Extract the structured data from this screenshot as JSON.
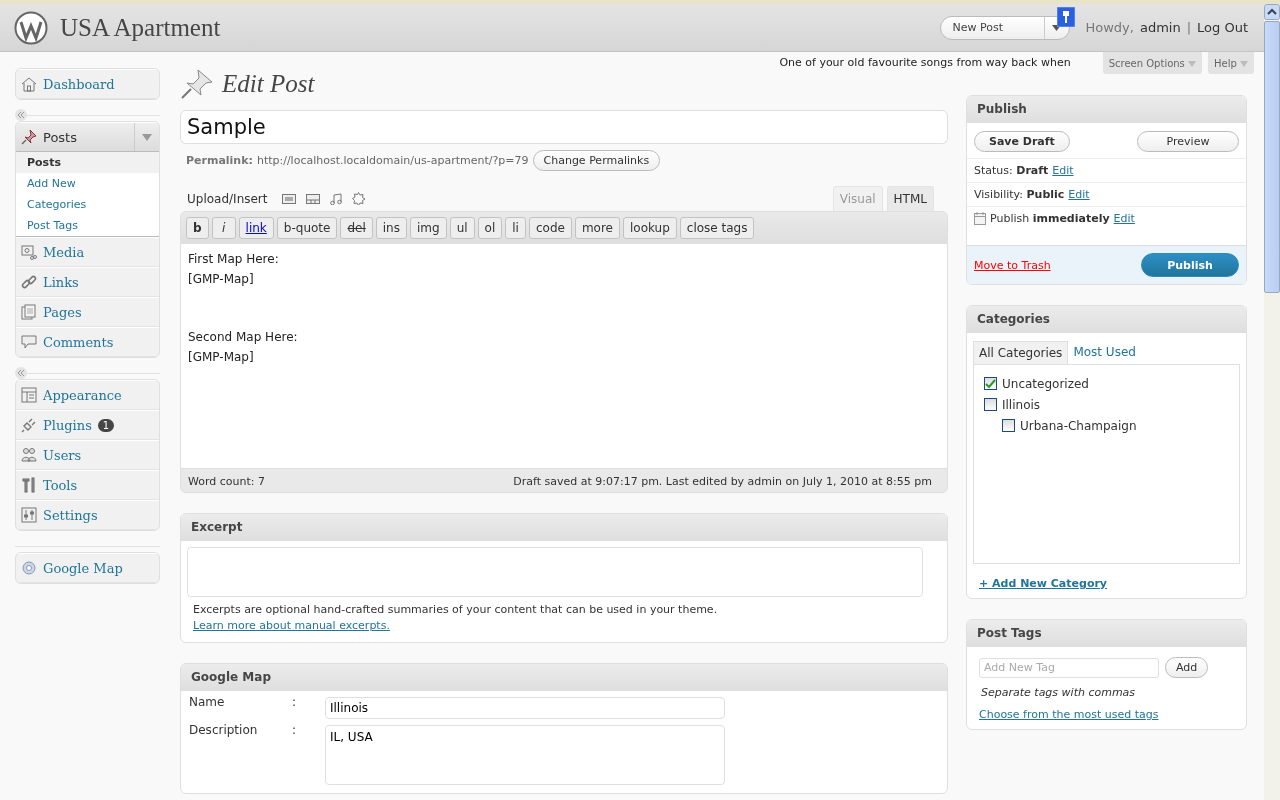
{
  "header": {
    "site_title": "USA Apartment",
    "new_post_button": "New Post",
    "greeting": "Howdy,",
    "user": "admin",
    "separator": "|",
    "logout": "Log Out"
  },
  "topbar": {
    "tagline": "One of your old favourite songs from way back when",
    "screen_options": "Screen Options",
    "help": "Help"
  },
  "page_title": "Edit Post",
  "sidebar": {
    "groups": [
      [
        {
          "label": "Dashboard"
        }
      ],
      [
        {
          "label": "Posts",
          "expanded": true,
          "children": [
            {
              "label": "Posts",
              "selected": true
            },
            {
              "label": "Add New",
              "selected": false
            },
            {
              "label": "Categories",
              "selected": false
            },
            {
              "label": "Post Tags",
              "selected": false
            }
          ]
        },
        {
          "label": "Media",
          "expanded": false
        },
        {
          "label": "Links",
          "expanded": false
        },
        {
          "label": "Pages",
          "expanded": false
        },
        {
          "label": "Comments",
          "expanded": false
        }
      ],
      [
        {
          "label": "Appearance"
        },
        {
          "label": "Plugins",
          "badge": "1"
        },
        {
          "label": "Users"
        },
        {
          "label": "Tools"
        },
        {
          "label": "Settings"
        }
      ],
      [
        {
          "label": "Google Map"
        }
      ]
    ]
  },
  "post": {
    "title": "Sample",
    "permalink_label": "Permalink:",
    "permalink_url": "http://localhost.localdomain/us-apartment/?p=79",
    "change_permalinks": "Change Permalinks"
  },
  "editor": {
    "upload_label": "Upload/Insert",
    "tabs": [
      {
        "label": "Visual",
        "selected": false
      },
      {
        "label": "HTML",
        "selected": true
      }
    ],
    "quicktags": [
      "b",
      "i",
      "link",
      "b-quote",
      "del",
      "ins",
      "img",
      "ul",
      "ol",
      "li",
      "code",
      "more",
      "lookup",
      "close tags"
    ],
    "content": "First Map Here:\n[GMP-Map]\n\n\nSecond Map Here:\n[GMP-Map]",
    "word_count": "Word count: 7",
    "save_status": "Draft saved at 9:07:17 pm. Last edited by admin on July 1, 2010 at 8:55 pm"
  },
  "excerpt": {
    "title": "Excerpt",
    "help": "Excerpts are optional hand-crafted summaries of your content that can be used in your theme.",
    "help_link": "Learn more about manual excerpts."
  },
  "google_map": {
    "title": "Google Map",
    "fields": [
      {
        "label": "Name",
        "colon": ":",
        "value": "Illinois",
        "kind": "input"
      },
      {
        "label": "Description",
        "colon": ":",
        "value": "IL, USA",
        "kind": "textarea"
      }
    ]
  },
  "publish": {
    "title": "Publish",
    "save_draft": "Save Draft",
    "preview": "Preview",
    "rows": [
      {
        "label": "Status:",
        "value": "Draft",
        "link": "Edit",
        "kind": "plain"
      },
      {
        "label": "Visibility:",
        "value": "Public",
        "link": "Edit",
        "kind": "plain"
      },
      {
        "label": "Publish",
        "value": "immediately",
        "link": "Edit",
        "kind": "calendar"
      }
    ],
    "trash": "Move to Trash",
    "publish_button": "Publish"
  },
  "categories": {
    "title": "Categories",
    "tabs": [
      {
        "label": "All Categories",
        "selected": true
      },
      {
        "label": "Most Used",
        "selected": false
      }
    ],
    "items": [
      {
        "label": "Uncategorized",
        "checked": true
      },
      {
        "label": "Illinois",
        "checked": false,
        "children": [
          {
            "label": "Urbana-Champaign",
            "checked": false
          }
        ]
      }
    ],
    "add_link": "+ Add New Category"
  },
  "tags": {
    "title": "Post Tags",
    "placeholder": "Add New Tag",
    "add_button": "Add",
    "hint": "Separate tags with commas",
    "choose_link": "Choose from the most used tags"
  }
}
